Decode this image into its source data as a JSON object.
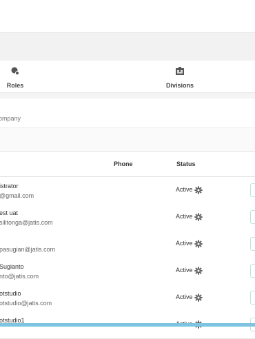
{
  "tabs": [
    {
      "label": "Roles",
      "icon": "roles-icon"
    },
    {
      "label": "Divisions",
      "icon": "divisions-icon"
    }
  ],
  "company": {
    "text": "ompany"
  },
  "table": {
    "columns": {
      "phone": "Phone",
      "status": "Status"
    },
    "rows": [
      {
        "name": "istrator",
        "email": "@gmail.com",
        "status": "Active"
      },
      {
        "name": "est uat",
        "email": "silitonga@jatis.com",
        "status": "Active"
      },
      {
        "name": "",
        "email": "pasugian@jatis.com",
        "status": "Active"
      },
      {
        "name": "Sugianto",
        "email": "nto@jatis.com",
        "status": "Active"
      },
      {
        "name": "otstudio",
        "email": "otstudio@jatis.com",
        "status": "Active"
      },
      {
        "name": "otstudio1",
        "email": "",
        "status": "Active"
      }
    ]
  },
  "colors": {
    "accent": "#5fb5a0",
    "bottom_bar": "#7ec3e0"
  }
}
